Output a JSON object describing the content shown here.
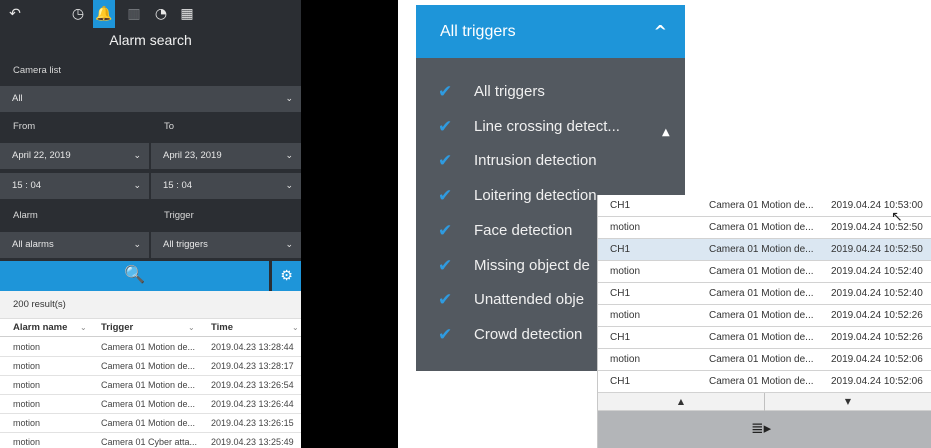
{
  "icons": {
    "back": "↶",
    "clock": "◷",
    "bell": "🔔",
    "stats": "▥",
    "camera_search": "◔",
    "grid": "▦",
    "chevron_down": "⌄",
    "search": "🔍",
    "gear": "⚙",
    "check": "✔",
    "caret_up": "▲",
    "caret_down": "▼",
    "playlist": "≣▸",
    "cursor": "↖"
  },
  "header": {
    "title": "Alarm search"
  },
  "form": {
    "camera_list_label": "Camera list",
    "camera_list_value": "All",
    "from_label": "From",
    "to_label": "To",
    "from_date": "April 22, 2019",
    "to_date": "April 23, 2019",
    "from_time": "15 : 04",
    "to_time": "15 : 04",
    "alarm_label": "Alarm",
    "trigger_label": "Trigger",
    "alarm_value": "All alarms",
    "trigger_value": "All triggers"
  },
  "results": {
    "count_text": "200 result(s)",
    "columns": [
      "Alarm name",
      "Trigger",
      "Time"
    ],
    "rows": [
      [
        "motion",
        "Camera 01 Motion de...",
        "2019.04.23 13:28:44"
      ],
      [
        "motion",
        "Camera 01 Motion de...",
        "2019.04.23 13:28:17"
      ],
      [
        "motion",
        "Camera 01 Motion de...",
        "2019.04.23 13:26:54"
      ],
      [
        "motion",
        "Camera 01 Motion de...",
        "2019.04.23 13:26:44"
      ],
      [
        "motion",
        "Camera 01 Motion de...",
        "2019.04.23 13:26:15"
      ],
      [
        "motion",
        "Camera 01 Cyber atta...",
        "2019.04.23 13:25:49"
      ]
    ]
  },
  "trigger_dropdown": {
    "title": "All triggers",
    "items": [
      "All triggers",
      "Line crossing detect...",
      "Intrusion detection",
      "Loitering detection",
      "Face detection",
      "Missing object de",
      "Unattended obje",
      "Crowd detection"
    ]
  },
  "event_list": {
    "rows": [
      [
        "CH1",
        "Camera 01 Motion de...",
        "2019.04.24 10:53:00"
      ],
      [
        "motion",
        "Camera 01 Motion de...",
        "2019.04.24 10:52:50"
      ],
      [
        "CH1",
        "Camera 01 Motion de...",
        "2019.04.24 10:52:50"
      ],
      [
        "motion",
        "Camera 01 Motion de...",
        "2019.04.24 10:52:40"
      ],
      [
        "CH1",
        "Camera 01 Motion de...",
        "2019.04.24 10:52:40"
      ],
      [
        "motion",
        "Camera 01 Motion de...",
        "2019.04.24 10:52:26"
      ],
      [
        "CH1",
        "Camera 01 Motion de...",
        "2019.04.24 10:52:26"
      ],
      [
        "motion",
        "Camera 01 Motion de...",
        "2019.04.24 10:52:06"
      ],
      [
        "CH1",
        "Camera 01 Motion de...",
        "2019.04.24 10:52:06"
      ]
    ],
    "selected_row": 2
  },
  "colors": {
    "accent": "#1e95d9",
    "panel_dark": "#2b2e33",
    "field_dark": "#44484e",
    "dropdown_bg": "#535960",
    "selected_row": "#dbe7f2"
  }
}
